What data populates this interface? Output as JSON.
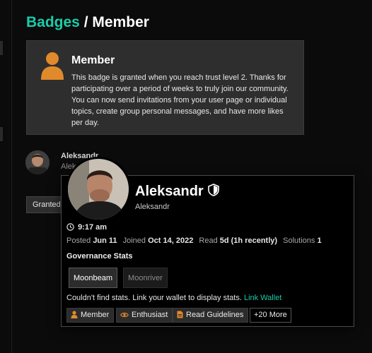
{
  "breadcrumb": {
    "section": "Badges",
    "separator": "/",
    "current": "Member"
  },
  "badge": {
    "title": "Member",
    "description": "This badge is granted when you reach trust level 2. Thanks for participating over a period of weeks to truly join our community. You can now send invitations from your user page or individual topics, create group personal messages, and have more likes per day.",
    "icon": "person-icon",
    "color": "#e08a2c"
  },
  "background_grant": {
    "name": "Aleksandr",
    "sub": "Alek",
    "granted_label": "Granted"
  },
  "user_card": {
    "display_name": "Aleksandr",
    "username": "Aleksandr",
    "local_time": "9:17 am",
    "stats": {
      "posted_label": "Posted",
      "posted_value": "Jun 11",
      "joined_label": "Joined",
      "joined_value": "Oct 14, 2022",
      "read_label": "Read",
      "read_value": "5d (1h recently)",
      "solutions_label": "Solutions",
      "solutions_value": "1"
    },
    "governance_title": "Governance Stats",
    "tabs": [
      "Moonbeam",
      "Moonriver"
    ],
    "wallet_message": "Couldn't find stats. Link your wallet to display stats.",
    "wallet_link": "Link Wallet",
    "badges": [
      {
        "label": "Member",
        "icon": "person-icon"
      },
      {
        "label": "Enthusiast",
        "icon": "eye-icon"
      },
      {
        "label": "Read Guidelines",
        "icon": "document-icon"
      }
    ],
    "more_label": "+20 More"
  },
  "colors": {
    "accent": "#1bcca8",
    "badge_bronze": "#e08a2c"
  }
}
